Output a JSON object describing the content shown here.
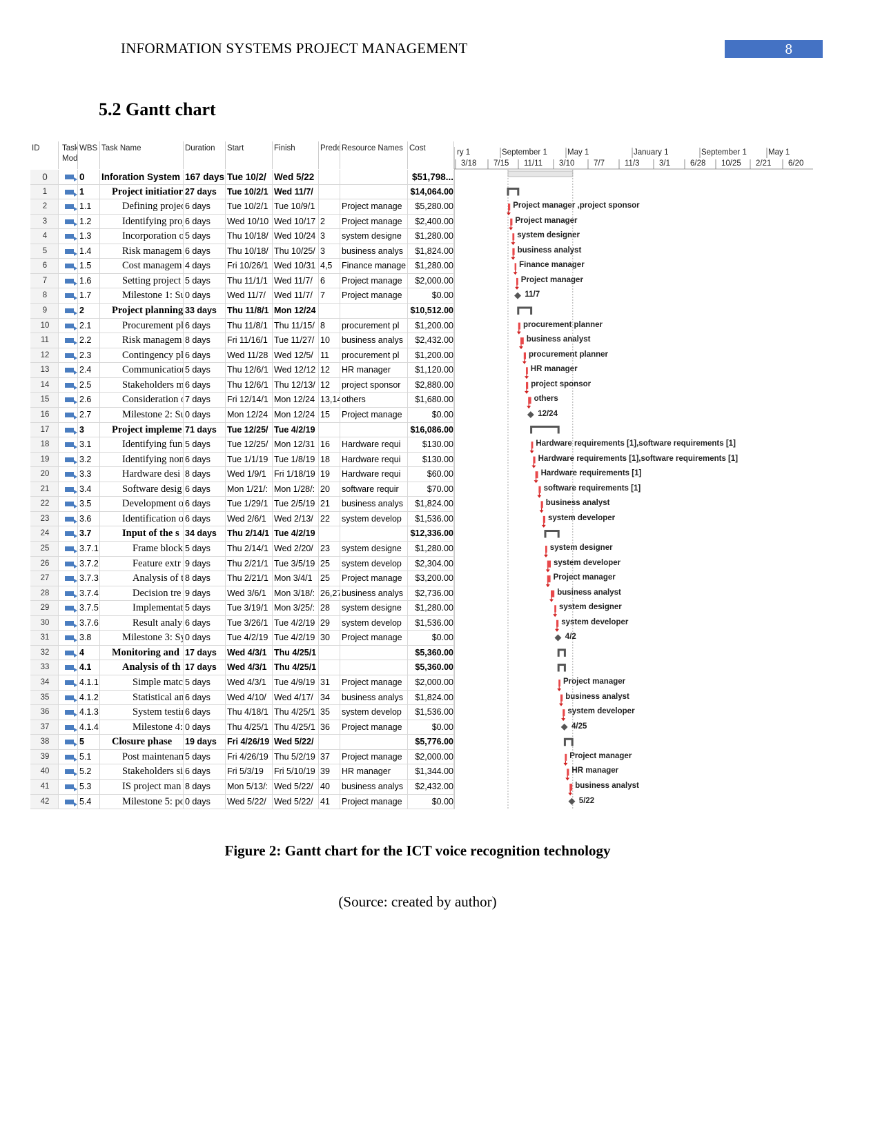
{
  "header": {
    "title": "INFORMATION SYSTEMS PROJECT MANAGEMENT",
    "page_number": "8",
    "accent": "#4472c4"
  },
  "section_heading": "5.2 Gantt chart",
  "table": {
    "columns": [
      "ID",
      "Task Mode",
      "WBS",
      "Task Name",
      "Duration",
      "Start",
      "Finish",
      "Prede",
      "Resource Names",
      "Cost"
    ],
    "rows": [
      [
        "0",
        "0",
        "Inforation System",
        "167 days",
        "Tue 10/2/",
        "Wed 5/22",
        "",
        "",
        "$51,798..."
      ],
      [
        "1",
        "1",
        "Project initiatior",
        "27 days",
        "Tue 10/2/1",
        "Wed 11/7/",
        "",
        "",
        "$14,064.00"
      ],
      [
        "2",
        "1.1",
        "Defining projec",
        "6 days",
        "Tue 10/2/1",
        "Tue 10/9/1",
        "",
        "Project manage",
        "$5,280.00"
      ],
      [
        "3",
        "1.2",
        "Identifying proj",
        "6 days",
        "Wed 10/10",
        "Wed 10/17",
        "2",
        "Project manage",
        "$2,400.00"
      ],
      [
        "4",
        "1.3",
        "Incorporation o",
        "5 days",
        "Thu 10/18/",
        "Wed 10/24",
        "3",
        "system designe",
        "$1,280.00"
      ],
      [
        "5",
        "1.4",
        "Risk managem",
        "6 days",
        "Thu 10/18/",
        "Thu 10/25/",
        "3",
        "business analys",
        "$1,824.00"
      ],
      [
        "6",
        "1.5",
        "Cost managem",
        "4 days",
        "Fri 10/26/1",
        "Wed 10/31",
        "4,5",
        "Finance manage",
        "$1,280.00"
      ],
      [
        "7",
        "1.6",
        "Setting project :",
        "5 days",
        "Thu 11/1/1",
        "Wed 11/7/",
        "6",
        "Project manage",
        "$2,000.00"
      ],
      [
        "8",
        "1.7",
        "Milestone 1: Su",
        "0 days",
        "Wed 11/7/",
        "Wed 11/7/",
        "7",
        "Project manage",
        "$0.00"
      ],
      [
        "9",
        "2",
        "Project planning",
        "33 days",
        "Thu 11/8/1",
        "Mon 12/24",
        "",
        "",
        "$10,512.00"
      ],
      [
        "10",
        "2.1",
        "Procurement pl",
        "6 days",
        "Thu 11/8/1",
        "Thu 11/15/",
        "8",
        "procurement pl",
        "$1,200.00"
      ],
      [
        "11",
        "2.2",
        "Risk managem",
        "8 days",
        "Fri 11/16/1",
        "Tue 11/27/",
        "10",
        "business analys",
        "$2,432.00"
      ],
      [
        "12",
        "2.3",
        "Contingency pl",
        "6 days",
        "Wed 11/28",
        "Wed 12/5/",
        "11",
        "procurement pl",
        "$1,200.00"
      ],
      [
        "13",
        "2.4",
        "Communication",
        "5 days",
        "Thu 12/6/1",
        "Wed 12/12",
        "12",
        "HR manager",
        "$1,120.00"
      ],
      [
        "14",
        "2.5",
        "Stakeholders m",
        "6 days",
        "Thu 12/6/1",
        "Thu 12/13/",
        "12",
        "project sponsor",
        "$2,880.00"
      ],
      [
        "15",
        "2.6",
        "Consideration o",
        "7 days",
        "Fri 12/14/1",
        "Mon 12/24",
        "13,14",
        "others",
        "$1,680.00"
      ],
      [
        "16",
        "2.7",
        "Milestone 2: Su",
        "0 days",
        "Mon 12/24",
        "Mon 12/24",
        "15",
        "Project manage",
        "$0.00"
      ],
      [
        "17",
        "3",
        "Project impleme",
        "71 days",
        "Tue 12/25/",
        "Tue 4/2/19",
        "",
        "",
        "$16,086.00"
      ],
      [
        "18",
        "3.1",
        "Identifying func",
        "5 days",
        "Tue 12/25/",
        "Mon 12/31",
        "16",
        "Hardware requi",
        "$130.00"
      ],
      [
        "19",
        "3.2",
        "Identifying non",
        "6 days",
        "Tue 1/1/19",
        "Tue 1/8/19",
        "18",
        "Hardware requi",
        "$130.00"
      ],
      [
        "20",
        "3.3",
        "Hardware desi",
        "8 days",
        "Wed 1/9/1",
        "Fri 1/18/19",
        "19",
        "Hardware requi",
        "$60.00"
      ],
      [
        "21",
        "3.4",
        "Software desig",
        "6 days",
        "Mon 1/21/:",
        "Mon 1/28/:",
        "20",
        "software requir",
        "$70.00"
      ],
      [
        "22",
        "3.5",
        "Development o",
        "6 days",
        "Tue 1/29/1",
        "Tue 2/5/19",
        "21",
        "business analys",
        "$1,824.00"
      ],
      [
        "23",
        "3.6",
        "Identification o",
        "6 days",
        "Wed 2/6/1",
        "Wed 2/13/",
        "22",
        "system develop",
        "$1,536.00"
      ],
      [
        "24",
        "3.7",
        "Input of the s",
        "34 days",
        "Thu 2/14/1",
        "Tue 4/2/19",
        "",
        "",
        "$12,336.00"
      ],
      [
        "25",
        "3.7.1",
        "Frame blocki",
        "5 days",
        "Thu 2/14/1",
        "Wed 2/20/",
        "23",
        "system designe",
        "$1,280.00"
      ],
      [
        "26",
        "3.7.2",
        "Feature extr",
        "9 days",
        "Thu 2/21/1",
        "Tue 3/5/19",
        "25",
        "system develop",
        "$2,304.00"
      ],
      [
        "27",
        "3.7.3",
        "Analysis of t",
        "8 days",
        "Thu 2/21/1",
        "Mon 3/4/1",
        "25",
        "Project manage",
        "$3,200.00"
      ],
      [
        "28",
        "3.7.4",
        "Decision tre",
        "9 days",
        "Wed 3/6/1",
        "Mon 3/18/:",
        "26,27",
        "business analys",
        "$2,736.00"
      ],
      [
        "29",
        "3.7.5",
        "Implementati",
        "5 days",
        "Tue 3/19/1",
        "Mon 3/25/:",
        "28",
        "system designe",
        "$1,280.00"
      ],
      [
        "30",
        "3.7.6",
        "Result analy",
        "6 days",
        "Tue 3/26/1",
        "Tue 4/2/19",
        "29",
        "system develop",
        "$1,536.00"
      ],
      [
        "31",
        "3.8",
        "Milestone 3: Sy",
        "0 days",
        "Tue 4/2/19",
        "Tue 4/2/19",
        "30",
        "Project manage",
        "$0.00"
      ],
      [
        "32",
        "4",
        "Monitoring and",
        "17 days",
        "Wed 4/3/1",
        "Thu 4/25/1",
        "",
        "",
        "$5,360.00"
      ],
      [
        "33",
        "4.1",
        "Analysis of th",
        "17 days",
        "Wed 4/3/1",
        "Thu 4/25/1",
        "",
        "",
        "$5,360.00"
      ],
      [
        "34",
        "4.1.1",
        "Simple matcl",
        "5 days",
        "Wed 4/3/1",
        "Tue 4/9/19",
        "31",
        "Project manage",
        "$2,000.00"
      ],
      [
        "35",
        "4.1.2",
        "Statistical an",
        "6 days",
        "Wed 4/10/",
        "Wed 4/17/",
        "34",
        "business analys",
        "$1,824.00"
      ],
      [
        "36",
        "4.1.3",
        "System testir",
        "6 days",
        "Thu 4/18/1",
        "Thu 4/25/1",
        "35",
        "system develop",
        "$1,536.00"
      ],
      [
        "37",
        "4.1.4",
        "Milestone 4:",
        "0 days",
        "Thu 4/25/1",
        "Thu 4/25/1",
        "36",
        "Project manage",
        "$0.00"
      ],
      [
        "38",
        "5",
        "Closure phase",
        "19 days",
        "Fri 4/26/19",
        "Wed 5/22/",
        "",
        "",
        "$5,776.00"
      ],
      [
        "39",
        "5.1",
        "Post maintenan",
        "5 days",
        "Fri 4/26/19",
        "Thu 5/2/19",
        "37",
        "Project manage",
        "$2,000.00"
      ],
      [
        "40",
        "5.2",
        "Stakeholders si",
        "6 days",
        "Fri 5/3/19",
        "Fri 5/10/19",
        "39",
        "HR manager",
        "$1,344.00"
      ],
      [
        "41",
        "5.3",
        "IS project man",
        "8 days",
        "Mon 5/13/:",
        "Wed 5/22/",
        "40",
        "business analys",
        "$2,432.00"
      ],
      [
        "42",
        "5.4",
        "Milestone 5: po",
        "0 days",
        "Wed 5/22/",
        "Wed 5/22/",
        "41",
        "Project manage",
        "$0.00"
      ]
    ]
  },
  "gantt": {
    "timescale_top": [
      "ry 1",
      "September 1",
      "May 1",
      "January 1",
      "September 1",
      "May 1"
    ],
    "timescale_bottom": [
      "3/18",
      "7/15",
      "11/11",
      "3/10",
      "7/7",
      "11/3",
      "3/1",
      "6/28",
      "10/25",
      "2/21",
      "6/20"
    ],
    "bar_labels": [
      "",
      "",
      "Project manager ,project sponsor",
      "Project manager",
      "system designer",
      "business analyst",
      "Finance manager",
      "Project manager",
      "11/7",
      "",
      "procurement planner",
      "business analyst",
      "procurement planner",
      "HR manager",
      "project sponsor",
      "others",
      "12/24",
      "",
      "Hardware requirements [1],software requirements [1]",
      "Hardware requirements [1],software requirements [1]",
      "Hardware requirements [1]",
      "software requirements [1]",
      "business analyst",
      "system developer",
      "",
      "system designer",
      "system developer",
      "Project manager",
      "business analyst",
      "system designer",
      "system developer",
      "4/2",
      "",
      "",
      "Project manager",
      "business analyst",
      "system developer",
      "4/25",
      "",
      "Project manager",
      "HR manager",
      "business analyst",
      "5/22"
    ],
    "colors": {
      "task_bar": "#e8484a",
      "summary": "#555555",
      "milestone": "#555555",
      "critical_link": "#d02020"
    }
  },
  "caption": "Figure 2: Gantt chart for the ICT voice recognition technology",
  "source": "(Source: created by author)"
}
